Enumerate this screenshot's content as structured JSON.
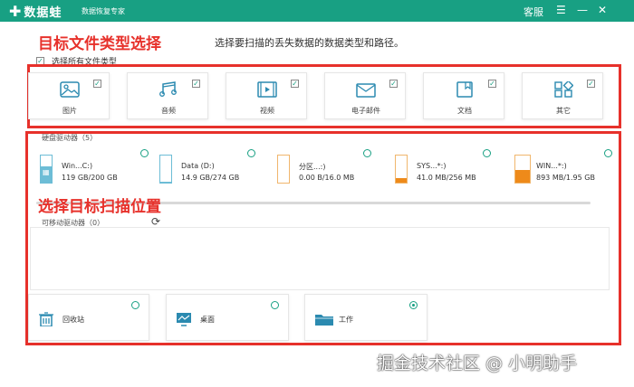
{
  "titlebar": {
    "logo_text": "数据蛙",
    "slogan": "数据恢复专家",
    "service_label": "客服",
    "menu_icon": "menu-icon",
    "minimize_icon": "minimize-icon",
    "close_icon": "close-icon"
  },
  "annotations": {
    "type_heading": "目标文件类型选择",
    "location_heading": "选择目标扫描位置"
  },
  "instruction": "选择要扫描的丢失数据的数据类型和路径。",
  "select_all": {
    "label": "选择所有文件类型",
    "checked": true
  },
  "file_types": [
    {
      "label": "图片",
      "icon": "image-icon",
      "checked": true
    },
    {
      "label": "音频",
      "icon": "music-icon",
      "checked": true
    },
    {
      "label": "视频",
      "icon": "video-icon",
      "checked": true
    },
    {
      "label": "电子邮件",
      "icon": "email-icon",
      "checked": true
    },
    {
      "label": "文档",
      "icon": "document-icon",
      "checked": true
    },
    {
      "label": "其它",
      "icon": "other-icon",
      "checked": true
    }
  ],
  "hard_drives": {
    "label": "硬盘驱动器（5）",
    "items": [
      {
        "name": "Win...C:)",
        "size": "119 GB/200 GB",
        "usage": 0.6,
        "color": "#6dbdd6",
        "icon": "windows-icon"
      },
      {
        "name": "Data (D:)",
        "size": "14.9 GB/274 GB",
        "usage": 0.05,
        "color": "#6dbdd6"
      },
      {
        "name": "分区...:)",
        "size": "0.00  B/16.0 MB",
        "usage": 0.0,
        "color": "#f0b66d"
      },
      {
        "name": "SYS...*:)",
        "size": "41.0 MB/256 MB",
        "usage": 0.16,
        "color": "#f0b66d"
      },
      {
        "name": "WIN...*:)",
        "size": "893 MB/1.95 GB",
        "usage": 0.46,
        "color": "#f0b66d"
      }
    ]
  },
  "removable": {
    "label": "可移动驱动器（0）",
    "refresh_icon": "refresh-icon"
  },
  "locations": [
    {
      "label": "回收站",
      "icon": "recycle-bin-icon",
      "selected": false
    },
    {
      "label": "桌面",
      "icon": "desktop-icon",
      "selected": false
    },
    {
      "label": "工作",
      "icon": "folder-icon",
      "selected": true
    }
  ],
  "watermark": {
    "text_a": "掘金技术社区",
    "at": "@",
    "text_b": "小明助手"
  },
  "colors": {
    "brand": "#18a083",
    "annotation": "#e7312b",
    "drive_blue": "#6dbdd6",
    "drive_orange": "#f0b66d",
    "fill_orange": "#ee8a1a"
  }
}
